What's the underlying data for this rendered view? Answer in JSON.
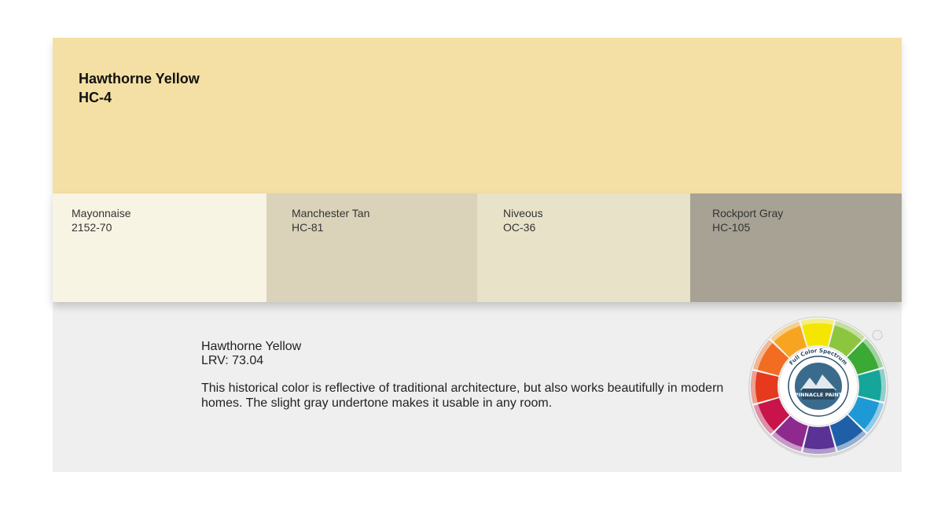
{
  "hero": {
    "name": "Hawthorne Yellow",
    "code": "HC-4",
    "color": "#f4e0a4"
  },
  "swatches": [
    {
      "name": "Mayonnaise",
      "code": "2152-70",
      "color": "#f8f4e4"
    },
    {
      "name": "Manchester Tan",
      "code": "HC-81",
      "color": "#dad2b9"
    },
    {
      "name": "Niveous",
      "code": "OC-36",
      "color": "#e8e2c9"
    },
    {
      "name": "Rockport Gray",
      "code": "HC-105",
      "color": "#a7a294"
    }
  ],
  "info": {
    "name": "Hawthorne Yellow",
    "lrv": "LRV: 73.04",
    "description": "This historical color is reflective of traditional architecture, but also works beautifully in modern homes. The slight gray undertone makes it usable in any room."
  },
  "wheel": {
    "ring_text": "Full Color Spectrum",
    "logo_text": "PINNACLE PAINT"
  }
}
